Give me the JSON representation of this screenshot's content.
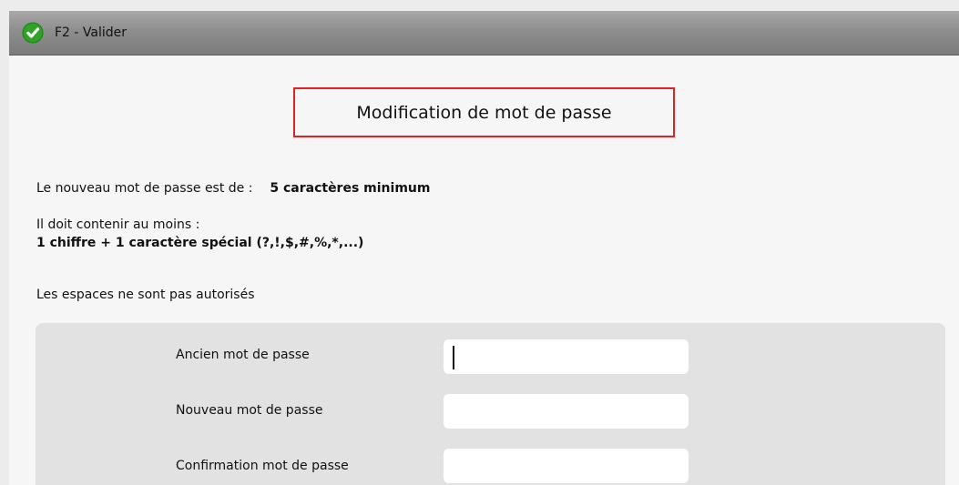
{
  "toolbar": {
    "validate_label": "F2 - Valider",
    "validate_icon": "check-circle-icon",
    "accent": "#22a61c"
  },
  "dialog": {
    "title": "Modification de mot de passe",
    "title_border_color": "#e22222"
  },
  "rules": {
    "length_label": "Le nouveau mot de passe est de :",
    "length_value": "5 caractères minimum",
    "contains_label": "Il doit contenir au moins :",
    "contains_value": "1 chiffre + 1 caractère spécial (?,!,$,#,%,*,...)",
    "spaces_label": "Les espaces ne sont pas autorisés"
  },
  "form": {
    "fields": [
      {
        "label": "Ancien mot de passe",
        "value": "",
        "placeholder": ""
      },
      {
        "label": "Nouveau mot de passe",
        "value": "",
        "placeholder": ""
      },
      {
        "label": "Confirmation mot de passe",
        "value": "",
        "placeholder": ""
      }
    ]
  }
}
